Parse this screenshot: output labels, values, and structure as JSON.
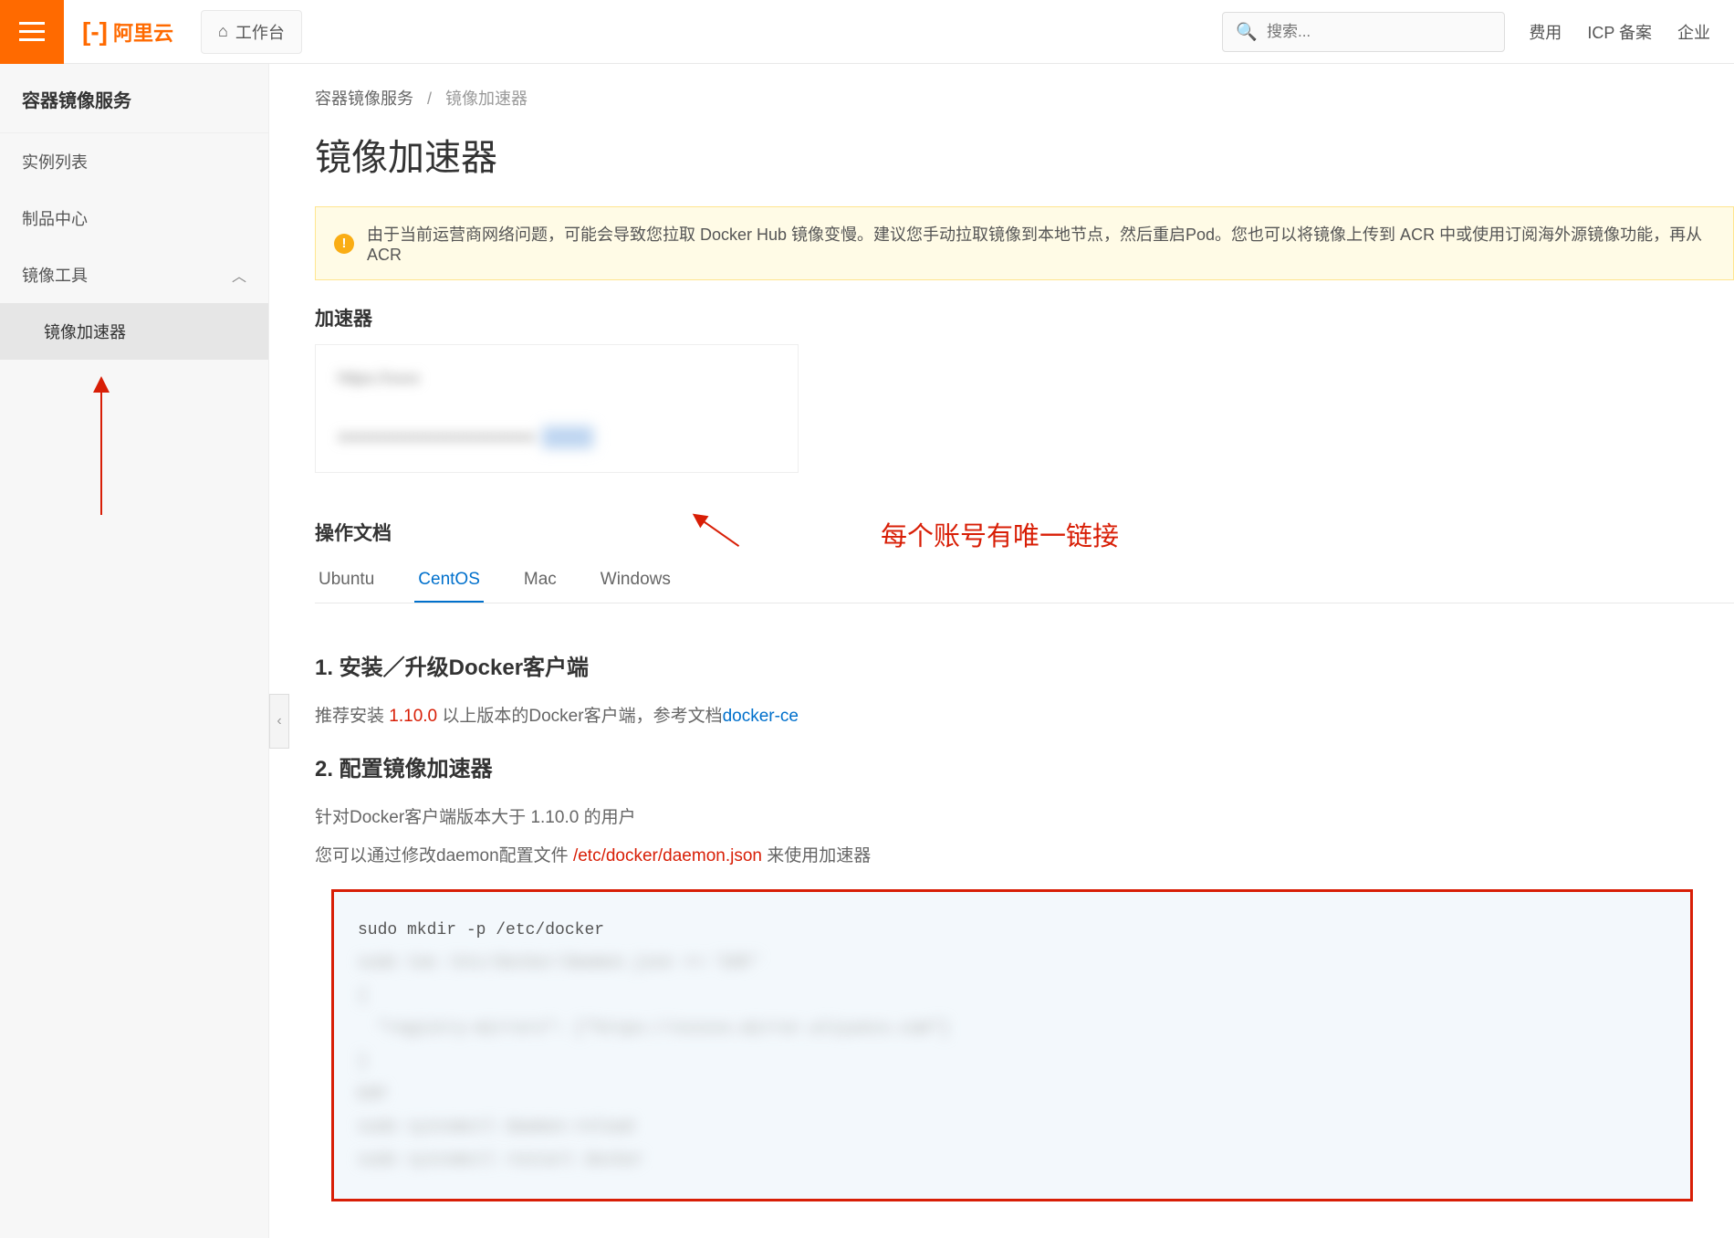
{
  "header": {
    "logo_text": "阿里云",
    "workbench": "工作台",
    "search_placeholder": "搜索...",
    "links": [
      "费用",
      "ICP 备案",
      "企业"
    ]
  },
  "sidebar": {
    "title": "容器镜像服务",
    "items": [
      {
        "label": "实例列表"
      },
      {
        "label": "制品中心"
      },
      {
        "label": "镜像工具",
        "expanded": true
      },
      {
        "label": "镜像加速器",
        "sub": true,
        "active": true
      }
    ]
  },
  "breadcrumb": {
    "item1": "容器镜像服务",
    "item2": "镜像加速器"
  },
  "page_title": "镜像加速器",
  "alert": "由于当前运营商网络问题，可能会导致您拉取 Docker Hub 镜像变慢。建议您手动拉取镜像到本地节点，然后重启Pod。您也可以将镜像上传到 ACR 中或使用订阅海外源镜像功能，再从 ACR",
  "accelerator": {
    "label": "加速器"
  },
  "annotation": "每个账号有唯一链接",
  "docs": {
    "label": "操作文档",
    "tabs": [
      "Ubuntu",
      "CentOS",
      "Mac",
      "Windows"
    ],
    "active_tab": 1,
    "section1_title": "1. 安装／升级Docker客户端",
    "section1_text_prefix": "推荐安装 ",
    "section1_version": "1.10.0",
    "section1_text_suffix": " 以上版本的Docker客户端，参考文档",
    "section1_link": "docker-ce",
    "section2_title": "2. 配置镜像加速器",
    "section2_line1": "针对Docker客户端版本大于 1.10.0 的用户",
    "section2_line2_prefix": "您可以通过修改daemon配置文件 ",
    "section2_path": "/etc/docker/daemon.json",
    "section2_line2_suffix": " 来使用加速器",
    "code_visible": "sudo mkdir -p /etc/docker"
  }
}
